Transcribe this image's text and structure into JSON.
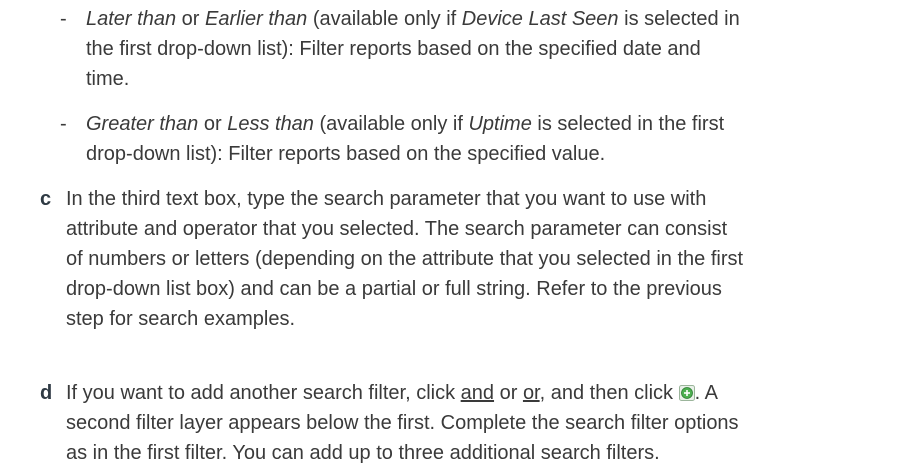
{
  "items": [
    {
      "marker": "-",
      "lines": [
        [
          {
            "t": "Later than",
            "i": true
          },
          {
            "t": " or "
          },
          {
            "t": "Earlier than",
            "i": true
          },
          {
            "t": " (available only if "
          },
          {
            "t": "Device Last Seen",
            "i": true
          },
          {
            "t": " is selected in"
          }
        ],
        [
          {
            "t": "the first drop-down list): Filter reports based on the specified date and"
          }
        ],
        [
          {
            "t": "time."
          }
        ]
      ]
    },
    {
      "marker": "-",
      "lines": [
        [
          {
            "t": "Greater than",
            "i": true
          },
          {
            "t": " or "
          },
          {
            "t": "Less than",
            "i": true
          },
          {
            "t": " (available only if "
          },
          {
            "t": "Uptime",
            "i": true
          },
          {
            "t": " is selected in the first"
          }
        ],
        [
          {
            "t": "drop-down list): Filter reports based on the specified value."
          }
        ]
      ]
    }
  ],
  "steps": [
    {
      "letter": "c",
      "lines": [
        "In the third text box, type the search parameter that you want to use with",
        "attribute and operator that you selected. The search parameter can consist",
        "of numbers or letters (depending on the attribute that you selected in the first",
        "drop-down list box) and can be a partial or full string. Refer to the previous",
        "step for search examples."
      ]
    },
    {
      "letter": "d",
      "line1": {
        "before_and": "If you want to add another search filter, click ",
        "and_link": "and",
        "between": " or ",
        "or_link": "or",
        "after": ", and then click ",
        "end": ". A"
      },
      "lines": [
        "second filter layer appears below the first. Complete the search filter options",
        "as in the first filter. You can add up to three additional search filters."
      ],
      "icon": "add-filter-icon",
      "icon_color": "#4caf50"
    }
  ],
  "colors": {
    "text": "#3a3a3a",
    "step_letter": "#2f3a44"
  }
}
